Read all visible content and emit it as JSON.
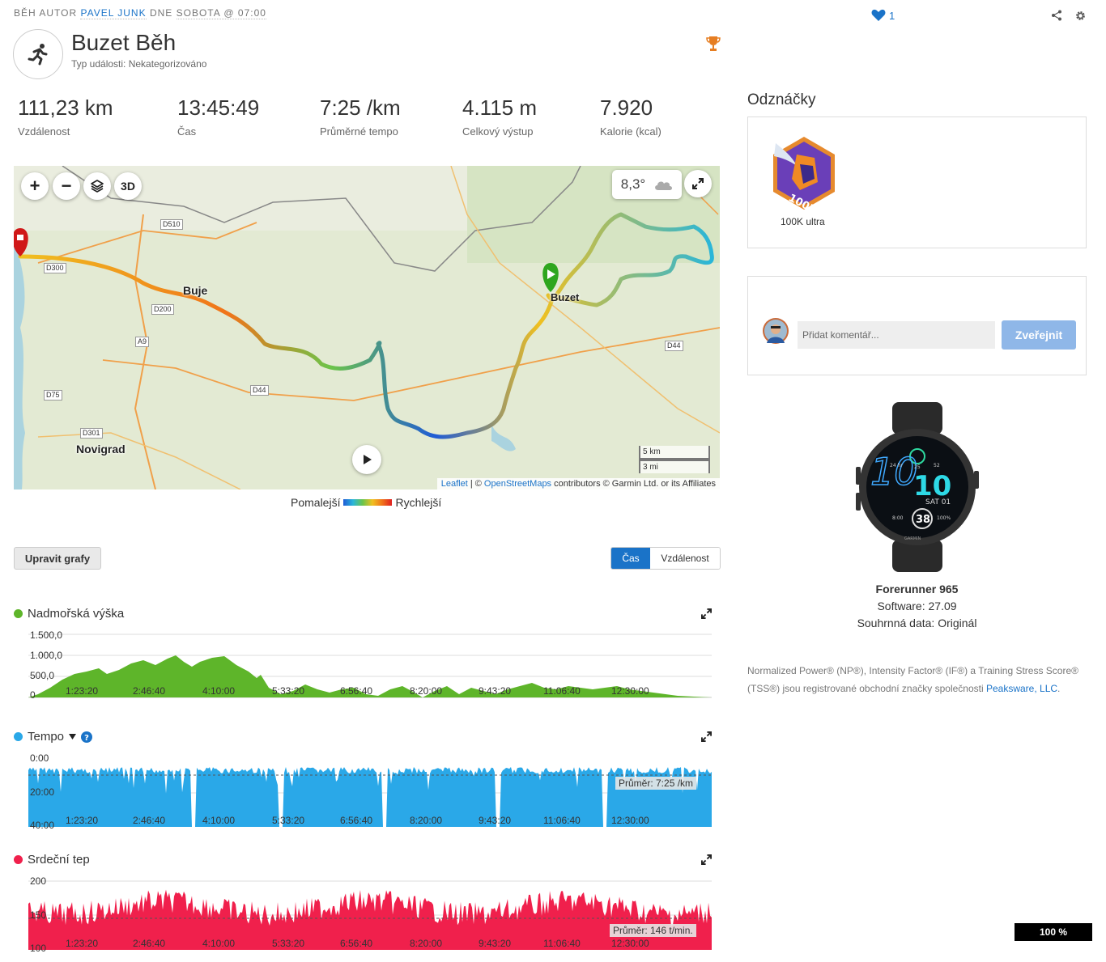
{
  "breadcrumb": {
    "prefix": "BĚH AUTOR ",
    "author": "PAVEL JUNK",
    "middle": " DNE ",
    "datetime": "SOBOTA @ 07:00"
  },
  "activity": {
    "title": "Buzet Běh",
    "event_type": "Typ události: Nekategorizováno"
  },
  "social": {
    "likes": "1"
  },
  "stats": [
    {
      "value": "111,23 km",
      "label": "Vzdálenost"
    },
    {
      "value": "13:45:49",
      "label": "Čas"
    },
    {
      "value": "7:25 /km",
      "label": "Průměrné tempo"
    },
    {
      "value": "4.115 m",
      "label": "Celkový výstup"
    },
    {
      "value": "7.920",
      "label": "Kalorie (kcal)"
    }
  ],
  "map": {
    "zoom_in": "+",
    "zoom_out": "−",
    "btn_3d": "3D",
    "temperature": "8,3°",
    "scale_km": "5 km",
    "scale_mi": "3 mi",
    "attribution_leaflet": "Leaflet",
    "attribution_sep": " | © ",
    "attribution_osm": "OpenStreetMaps",
    "attribution_rest": " contributors © Garmin Ltd. or its Affiliates",
    "places": [
      "Buje",
      "Novigrad",
      "Buzet"
    ],
    "roads": [
      "D510",
      "D300",
      "D200",
      "A9",
      "D44",
      "D75",
      "D301",
      "D44"
    ]
  },
  "legend": {
    "slower": "Pomalejší",
    "faster": "Rychlejší"
  },
  "controls": {
    "edit_charts": "Upravit grafy",
    "toggle_time": "Čas",
    "toggle_distance": "Vzdálenost"
  },
  "x_ticks": [
    "1:23:20",
    "2:46:40",
    "4:10:00",
    "5:33:20",
    "6:56:40",
    "8:20:00",
    "9:43:20",
    "11:06:40",
    "12:30:00"
  ],
  "charts": {
    "elevation": {
      "title": "Nadmořská výška",
      "color": "#5eb52a",
      "y_ticks": [
        "1.500,0",
        "1.000,0",
        "500,0",
        "0"
      ]
    },
    "pace": {
      "title": "Tempo",
      "color": "#2aa8e8",
      "y_ticks": [
        "0:00",
        "20:00",
        "40:00"
      ],
      "avg": "Průměr: 7:25 /km"
    },
    "heart": {
      "title": "Srdeční tep",
      "color": "#f0204c",
      "y_ticks": [
        "200",
        "150",
        "100"
      ],
      "avg": "Průměr: 146 t/min."
    }
  },
  "chart_data": [
    {
      "type": "area",
      "title": "Nadmořská výška",
      "x": [
        "0:00:00",
        "1:23:20",
        "2:46:40",
        "4:10:00",
        "5:33:20",
        "6:56:40",
        "8:20:00",
        "9:43:20",
        "11:06:40",
        "12:30:00",
        "13:45:49"
      ],
      "values": [
        80,
        620,
        720,
        880,
        120,
        350,
        300,
        250,
        360,
        180,
        60
      ],
      "ylim": [
        0,
        1500
      ]
    },
    {
      "type": "area",
      "title": "Tempo",
      "x": [
        "1:23:20",
        "2:46:40",
        "4:10:00",
        "5:33:20",
        "6:56:40",
        "8:20:00",
        "9:43:20",
        "11:06:40",
        "12:30:00"
      ],
      "avg_label": "Průměr: 7:25 /km",
      "ylim": [
        "0:00",
        "40:00"
      ]
    },
    {
      "type": "area",
      "title": "Srdeční tep",
      "x": [
        "1:23:20",
        "2:46:40",
        "4:10:00",
        "5:33:20",
        "6:56:40",
        "8:20:00",
        "9:43:20",
        "11:06:40",
        "12:30:00"
      ],
      "avg": 146,
      "ylim": [
        100,
        200
      ]
    }
  ],
  "badges": {
    "heading": "Odznáčky",
    "items": [
      {
        "label": "100K ultra",
        "badge_text": "100K"
      }
    ]
  },
  "comments": {
    "placeholder": "Přidat komentář...",
    "publish": "Zveřejnit"
  },
  "device": {
    "name": "Forerunner 965",
    "software": "Software: 27.09",
    "summary": "Souhrnná data: Originál",
    "watch_big_left": "10",
    "watch_big_right": "10",
    "watch_date": "SAT 01",
    "watch_center": "38",
    "watch_24hr": "24 hr",
    "watch_25": "25",
    "watch_52": "52",
    "watch_800": "8:00",
    "watch_100": "100%",
    "watch_brand": "GARMIN"
  },
  "note": {
    "text": "Normalized Power® (NP®), Intensity Factor® (IF®) a Training Stress Score® (TSS®) jsou registrované obchodní značky společnosti ",
    "link": "Peaksware, LLC",
    "end": "."
  },
  "zoom": "100 %"
}
